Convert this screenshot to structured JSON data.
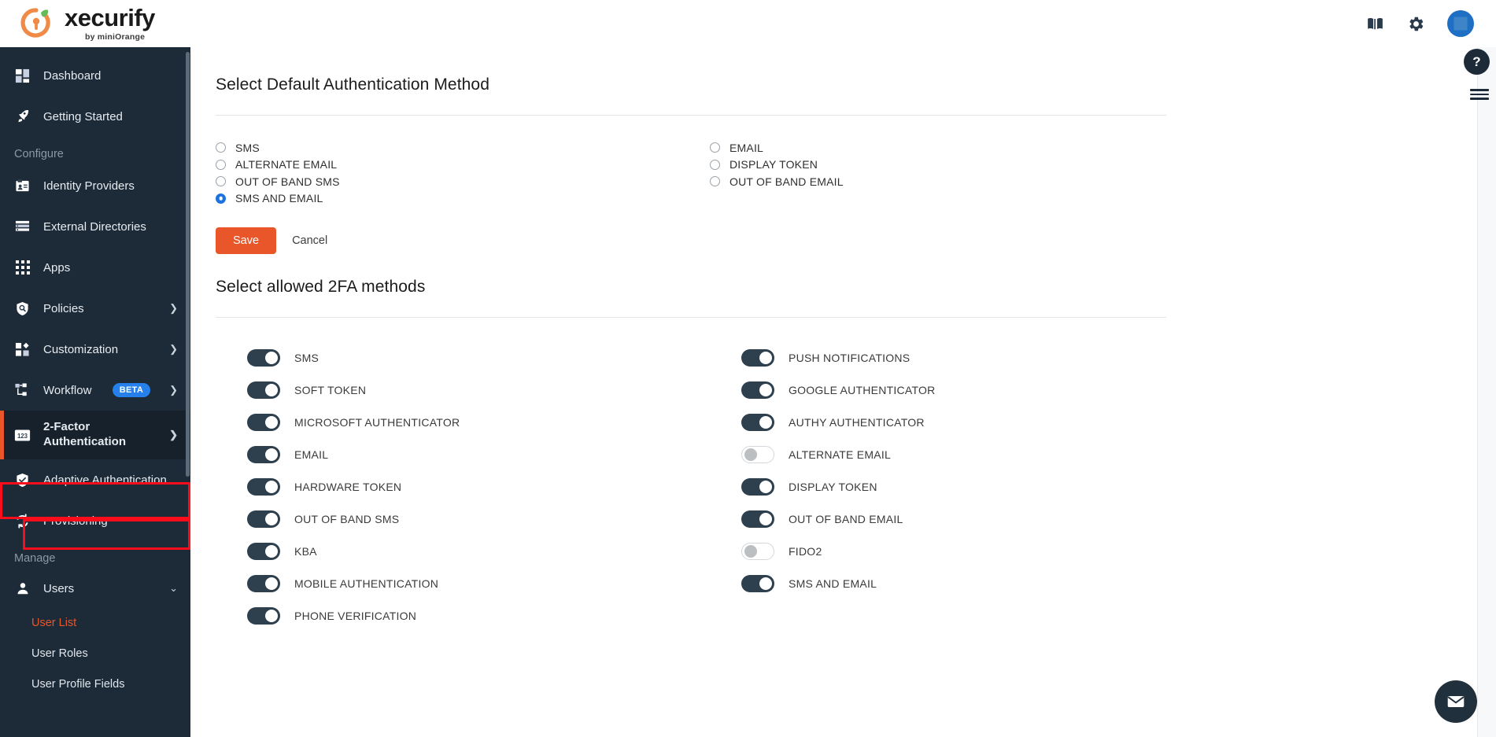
{
  "header": {
    "logo_name": "xecurify",
    "logo_sub": "by miniOrange",
    "icons": [
      {
        "name": "book-icon",
        "label": "Documentation"
      },
      {
        "name": "gear-icon",
        "label": "Settings"
      },
      {
        "name": "avatar",
        "label": "Account"
      }
    ]
  },
  "sidebar": {
    "top_items": [
      {
        "label": "Dashboard",
        "icon": "dashboard-icon"
      },
      {
        "label": "Getting Started",
        "icon": "rocket-icon"
      }
    ],
    "configure_label": "Configure",
    "configure_items": [
      {
        "label": "Identity Providers",
        "icon": "id-card-icon",
        "chevron": false
      },
      {
        "label": "External Directories",
        "icon": "list-icon",
        "chevron": false
      },
      {
        "label": "Apps",
        "icon": "grid-icon",
        "chevron": false
      },
      {
        "label": "Policies",
        "icon": "shield-search-icon",
        "chevron": true
      },
      {
        "label": "Customization",
        "icon": "customization-icon",
        "chevron": true
      },
      {
        "label": "Workflow",
        "icon": "workflow-icon",
        "chevron": true,
        "badge": "BETA"
      },
      {
        "label": "2-Factor Authentication",
        "icon": "numeric-123-icon",
        "chevron": true,
        "active": true
      },
      {
        "label": "Adaptive Authentication",
        "icon": "shield-check-icon",
        "chevron": false
      },
      {
        "label": "Provisioning",
        "icon": "sync-icon",
        "chevron": false
      }
    ],
    "manage_label": "Manage",
    "manage_items": [
      {
        "label": "Users",
        "icon": "user-icon",
        "chevron": true,
        "expanded": true
      }
    ],
    "user_subitems": [
      {
        "label": "User List",
        "highlight": true
      },
      {
        "label": "User Roles",
        "highlight": false
      },
      {
        "label": "User Profile Fields",
        "highlight": false
      }
    ]
  },
  "main": {
    "default_method": {
      "title": "Select Default Authentication Method",
      "left_options": [
        {
          "label": "SMS",
          "selected": false
        },
        {
          "label": "ALTERNATE EMAIL",
          "selected": false
        },
        {
          "label": "OUT OF BAND SMS",
          "selected": false
        },
        {
          "label": "SMS AND EMAIL",
          "selected": true
        }
      ],
      "right_options": [
        {
          "label": "EMAIL",
          "selected": false
        },
        {
          "label": "DISPLAY TOKEN",
          "selected": false
        },
        {
          "label": "OUT OF BAND EMAIL",
          "selected": false
        }
      ],
      "save_label": "Save",
      "cancel_label": "Cancel"
    },
    "allowed_methods": {
      "title": "Select allowed 2FA methods",
      "left_toggles": [
        {
          "label": "SMS",
          "on": true
        },
        {
          "label": "SOFT TOKEN",
          "on": true
        },
        {
          "label": "MICROSOFT AUTHENTICATOR",
          "on": true
        },
        {
          "label": "EMAIL",
          "on": true
        },
        {
          "label": "HARDWARE TOKEN",
          "on": true
        },
        {
          "label": "OUT OF BAND SMS",
          "on": true
        },
        {
          "label": "KBA",
          "on": true
        },
        {
          "label": "MOBILE AUTHENTICATION",
          "on": true
        },
        {
          "label": "PHONE VERIFICATION",
          "on": true
        }
      ],
      "right_toggles": [
        {
          "label": "PUSH NOTIFICATIONS",
          "on": true
        },
        {
          "label": "GOOGLE AUTHENTICATOR",
          "on": true
        },
        {
          "label": "AUTHY AUTHENTICATOR",
          "on": true
        },
        {
          "label": "ALTERNATE EMAIL",
          "on": false
        },
        {
          "label": "DISPLAY TOKEN",
          "on": true
        },
        {
          "label": "OUT OF BAND EMAIL",
          "on": true
        },
        {
          "label": "FIDO2",
          "on": false
        },
        {
          "label": "SMS AND EMAIL",
          "on": true
        }
      ]
    }
  },
  "rail": {
    "help_label": "?",
    "menu_icon": "hamburger-icon",
    "chat_icon": "envelope-icon"
  },
  "colors": {
    "accent_orange": "#e8562a",
    "sidebar_bg": "#1d2b38",
    "toggle_on": "#2e3f4e",
    "radio_blue": "#1c72e0",
    "annotation_red": "#fc0d1b",
    "beta_blue": "#2680eb"
  }
}
